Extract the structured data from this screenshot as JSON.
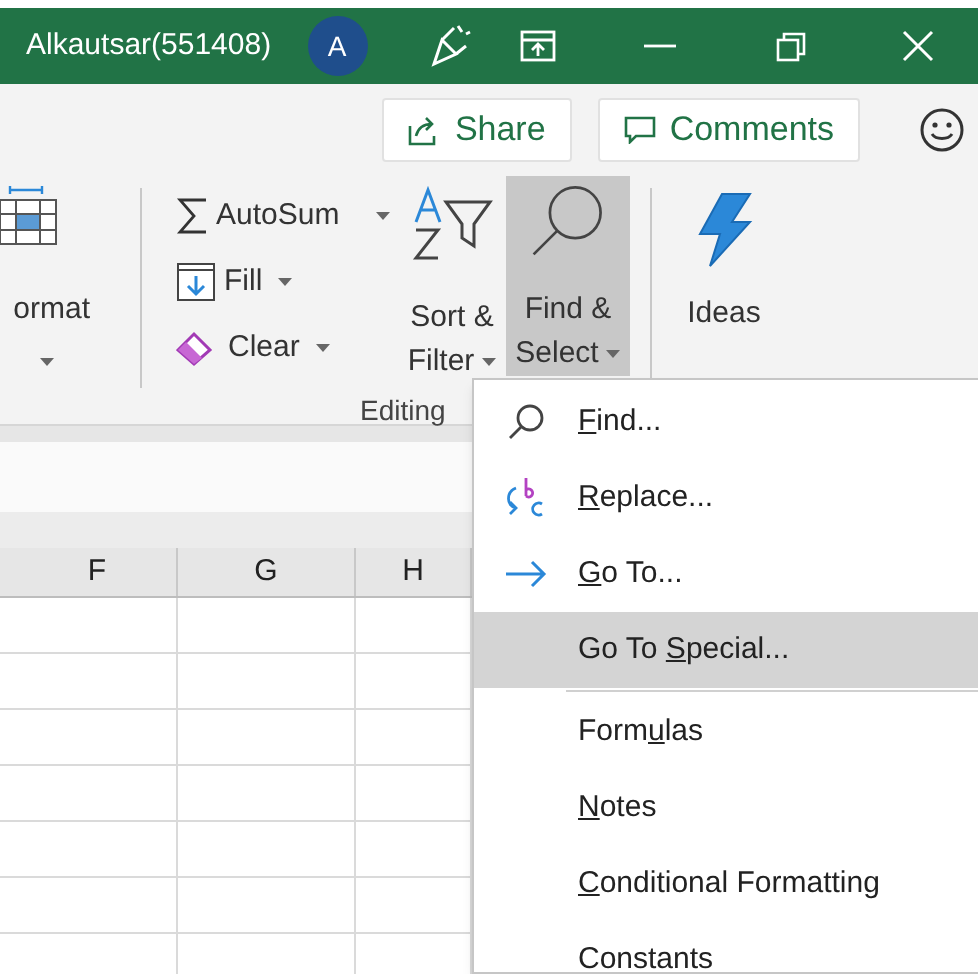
{
  "title_bar": {
    "user": "Alkautsar(551408)",
    "avatar": "A"
  },
  "ribbon_actions": [
    {
      "label": "Share",
      "kind": "share"
    },
    {
      "label": "Comments",
      "kind": "comments"
    }
  ],
  "ribbon": {
    "format": {
      "label": "ormat"
    },
    "editing": {
      "items": [
        {
          "label": "AutoSum",
          "kind": "autosum"
        },
        {
          "label": "Fill",
          "kind": "fill"
        },
        {
          "label": "Clear",
          "kind": "clear"
        }
      ],
      "sort": {
        "line1": "Sort &",
        "line2": "Filter"
      },
      "find": {
        "line1": "Find &",
        "line2": "Select",
        "selected": true
      },
      "group_label": "Editing"
    },
    "ideas": {
      "label": "Ideas"
    }
  },
  "sheet": {
    "columns": [
      "F",
      "G",
      "H"
    ]
  },
  "menu": {
    "items": [
      {
        "access_key": "F",
        "label_rest": "ind...",
        "kind": "find",
        "selected": false,
        "divider_above": false
      },
      {
        "access_key": "R",
        "label_rest": "eplace...",
        "kind": "replace",
        "selected": false,
        "divider_above": false
      },
      {
        "access_key": "G",
        "label_rest": "o To...",
        "kind": "goto",
        "selected": false,
        "divider_above": false
      },
      {
        "label": "Go To ",
        "access_key": "S",
        "label_rest": "pecial...",
        "kind": "plain",
        "selected": true,
        "divider_above": false
      },
      {
        "label": "Form",
        "access_key": "u",
        "label_rest": "las",
        "kind": "plain",
        "selected": false,
        "divider_above": true
      },
      {
        "access_key": "N",
        "label_rest": "otes",
        "kind": "plain",
        "selected": false,
        "divider_above": false
      },
      {
        "access_key": "C",
        "label_rest": "onditional Formatting",
        "kind": "plain",
        "selected": false,
        "divider_above": false
      },
      {
        "label": "Constants",
        "kind": "plain",
        "selected": false,
        "divider_above": false
      }
    ]
  }
}
